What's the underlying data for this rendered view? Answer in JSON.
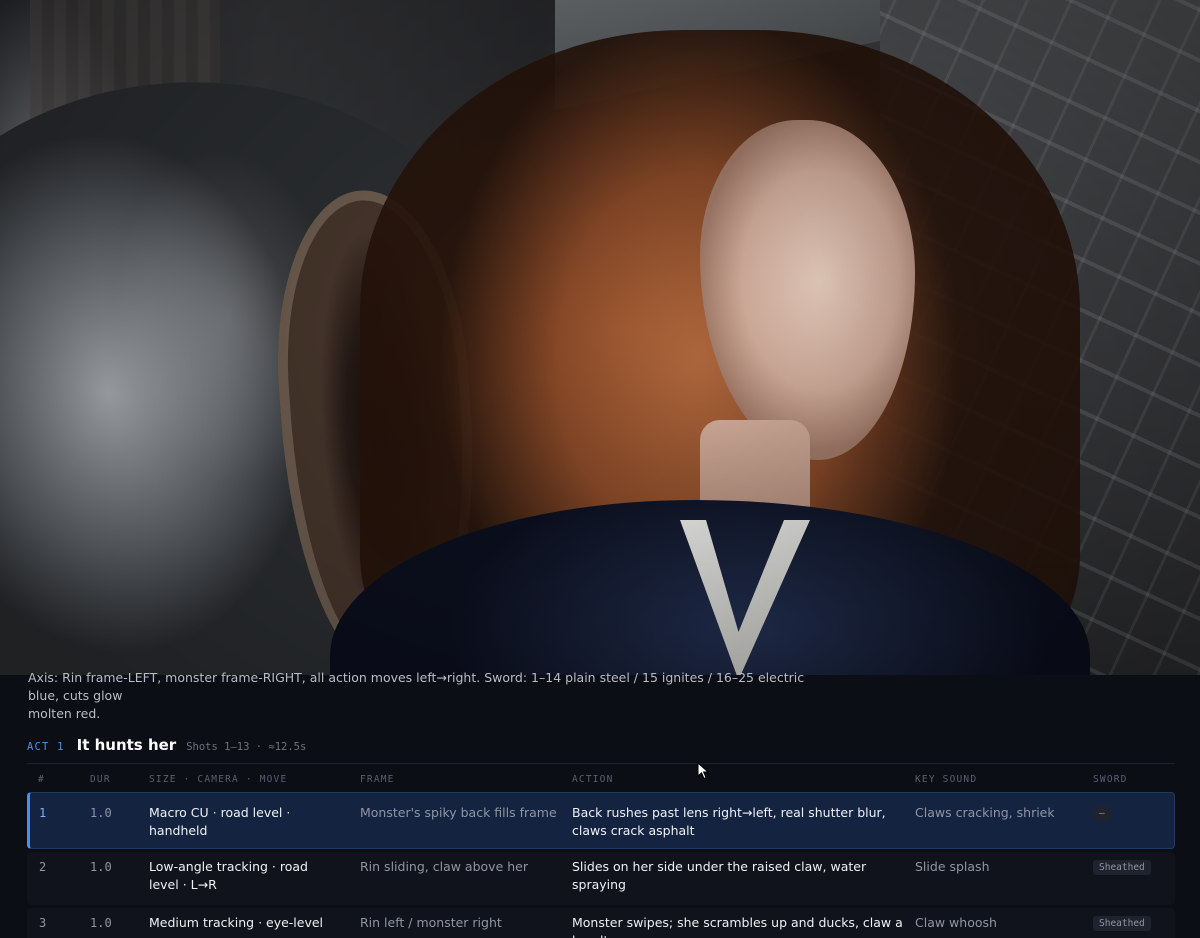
{
  "note": {
    "line1": "Axis: Rin frame-LEFT, monster frame-RIGHT, all action moves left→right. Sword: 1–14 plain steel / 15 ignites / 16–25 electric blue, cuts glow",
    "line2": "molten red."
  },
  "act": {
    "label": "ACT 1",
    "title": "It hunts her",
    "meta": "Shots 1–13 · ≈12.5s"
  },
  "columns": {
    "num": "#",
    "dur": "DUR",
    "size": "SIZE · CAMERA · MOVE",
    "frame": "FRAME",
    "action": "ACTION",
    "sound": "KEY SOUND",
    "sword": "SWORD"
  },
  "rows": [
    {
      "num": "1",
      "dur": "1.0",
      "size": "Macro CU · road level · handheld",
      "frame": "Monster's spiky back fills frame",
      "action": "Back rushes past lens right→left, real shutter blur, claws crack asphalt",
      "sound": "Claws cracking, shriek",
      "sword": "—"
    },
    {
      "num": "2",
      "dur": "1.0",
      "size": "Low-angle tracking · road level · L→R",
      "frame": "Rin sliding, claw above her",
      "action": "Slides on her side under the raised claw, water spraying",
      "sound": "Slide splash",
      "sword": "Sheathed"
    },
    {
      "num": "3",
      "dur": "1.0",
      "size": "Medium tracking · eye-level",
      "frame": "Rin left / monster right",
      "action": "Monster swipes; she scrambles up and ducks, claw a hand's",
      "sound": "Claw whoosh",
      "sword": "Sheathed"
    }
  ],
  "colors": {
    "accent": "#4a8ff0",
    "background": "#0b0e15",
    "active_row": "#142340"
  }
}
